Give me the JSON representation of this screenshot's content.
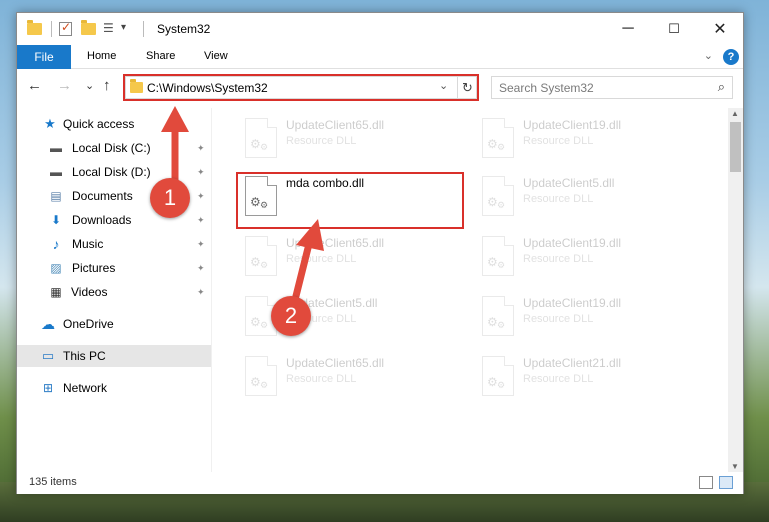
{
  "window": {
    "title": "System32",
    "qa_dropdown": "▾",
    "controls": {
      "minimize": "─",
      "maximize": "☐",
      "close": "✕"
    }
  },
  "ribbon": {
    "file_tab": "File",
    "tabs": [
      "Home",
      "Share",
      "View"
    ],
    "collapse_glyph": "⌄",
    "help_glyph": "?"
  },
  "navigation": {
    "back_glyph": "←",
    "forward_glyph": "→",
    "recent_glyph": "⌄",
    "up_glyph": "↑",
    "address": "C:\\Windows\\System32",
    "address_drop_glyph": "⌄",
    "refresh_glyph": "↻",
    "search_placeholder": "Search System32",
    "search_glyph": "⌕"
  },
  "sidebar": {
    "quick_access": "Quick access",
    "items": [
      {
        "label": "Local Disk (C:)",
        "icon": "drive-icon",
        "glyph": "▬",
        "pinned": true
      },
      {
        "label": "Local Disk (D:)",
        "icon": "drive-icon",
        "glyph": "▬",
        "pinned": true
      },
      {
        "label": "Documents",
        "icon": "documents-icon",
        "glyph": "▤",
        "pinned": true
      },
      {
        "label": "Downloads",
        "icon": "downloads-icon",
        "glyph": "⬇",
        "pinned": true
      },
      {
        "label": "Music",
        "icon": "music-icon",
        "glyph": "♪",
        "pinned": true
      },
      {
        "label": "Pictures",
        "icon": "pictures-icon",
        "glyph": "▨",
        "pinned": true
      },
      {
        "label": "Videos",
        "icon": "videos-icon",
        "glyph": "▦",
        "pinned": true
      }
    ],
    "onedrive": "OneDrive",
    "this_pc": "This PC",
    "network": "Network",
    "pin_glyph": "📌"
  },
  "files": [
    {
      "name": "UpdateClient65.dll",
      "type": "Resource DLL",
      "faded": true
    },
    {
      "name": "UpdateClient19.dll",
      "type": "Resource DLL",
      "faded": true
    },
    {
      "name": "mda combo.dll",
      "type": "",
      "faded": false
    },
    {
      "name": "UpdateClient5.dll",
      "type": "Resource DLL",
      "faded": true
    },
    {
      "name": "UpdateClient65.dll",
      "type": "Resource DLL",
      "faded": true
    },
    {
      "name": "UpdateClient19.dll",
      "type": "Resource DLL",
      "faded": true
    },
    {
      "name": "UpdateClient5.dll",
      "type": "Resource DLL",
      "faded": true
    },
    {
      "name": "UpdateClient19.dll",
      "type": "Resource DLL",
      "faded": true
    },
    {
      "name": "UpdateClient65.dll",
      "type": "Resource DLL",
      "faded": true
    },
    {
      "name": "UpdateClient21.dll",
      "type": "Resource DLL",
      "faded": true
    }
  ],
  "status": {
    "count": "135 items"
  },
  "annotations": {
    "step1": "1",
    "step2": "2",
    "accent": "#e14a3c"
  },
  "colors": {
    "file_tab": "#1979ca",
    "highlight": "#d9302a",
    "selected": "#e6e6e6"
  }
}
